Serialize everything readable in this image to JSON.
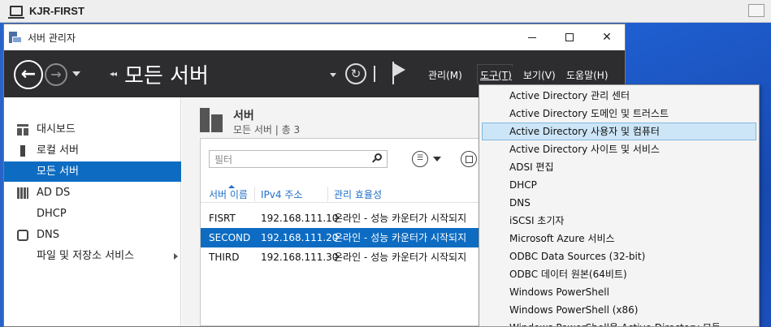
{
  "vm": {
    "title": "KJR-FIRST"
  },
  "window": {
    "title": "서버 관리자"
  },
  "header": {
    "page_title": "모든 서버",
    "breadcrumb_arrows": "◂◂",
    "menus": {
      "manage": "관리(M)",
      "tools": "도구(T)",
      "view": "보기(V)",
      "help": "도움말(H)"
    }
  },
  "sidebar": {
    "items": [
      {
        "label": "대시보드"
      },
      {
        "label": "로컬 서버"
      },
      {
        "label": "모든 서버"
      },
      {
        "label": "AD DS"
      },
      {
        "label": "DHCP"
      },
      {
        "label": "DNS"
      },
      {
        "label": "파일 및 저장소 서비스"
      }
    ]
  },
  "servers": {
    "title": "서버",
    "subtitle": "모든 서버 | 총 3",
    "filter_placeholder": "필터",
    "columns": {
      "name": "서버 이름",
      "ip": "IPv4 주소",
      "mgmt": "관리 효율성"
    },
    "rows": [
      {
        "name": "FISRT",
        "ip": "192.168.111.10",
        "status": "온라인 - 성능 카운터가 시작되지"
      },
      {
        "name": "SECOND",
        "ip": "192.168.111.20",
        "status": "온라인 - 성능 카운터가 시작되지"
      },
      {
        "name": "THIRD",
        "ip": "192.168.111.30",
        "status": "온라인 - 성능 카운터가 시작되지"
      }
    ]
  },
  "tools_menu": {
    "items": [
      "Active Directory 관리 센터",
      "Active Directory 도메인 및 트러스트",
      "Active Directory 사용자 및 컴퓨터",
      "Active Directory 사이트 및 서비스",
      "ADSI 편집",
      "DHCP",
      "DNS",
      "iSCSI 초기자",
      "Microsoft Azure 서비스",
      "ODBC Data Sources (32-bit)",
      "ODBC 데이터 원본(64비트)",
      "Windows PowerShell",
      "Windows PowerShell (x86)",
      "Windows PowerShell용 Active Directory 모듈"
    ]
  }
}
